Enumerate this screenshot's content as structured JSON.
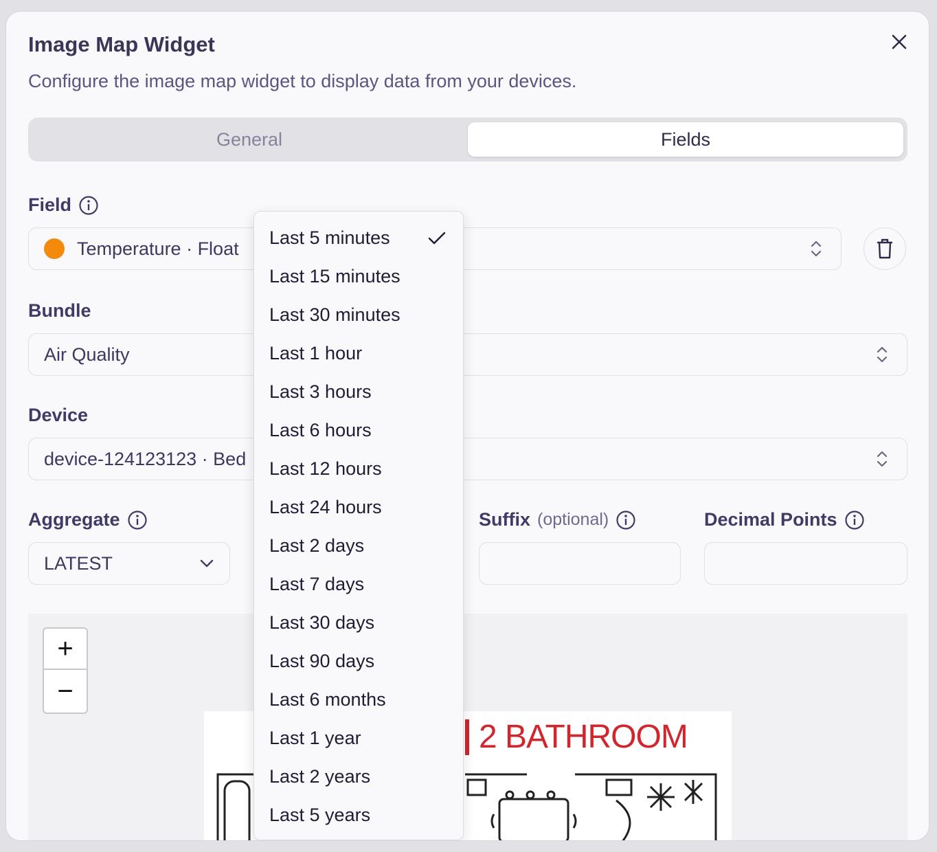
{
  "dialog": {
    "title": "Image Map Widget",
    "description": "Configure the image map widget to display data from your devices."
  },
  "tabs": [
    {
      "label": "General",
      "active": false
    },
    {
      "label": "Fields",
      "active": true
    }
  ],
  "field": {
    "label": "Field",
    "value": "Temperature · Float",
    "dot_color": "#f48a0c"
  },
  "bundle": {
    "label": "Bundle",
    "value": "Air Quality"
  },
  "device": {
    "label": "Device",
    "value": "device-124123123 · Bed"
  },
  "aggregate": {
    "label": "Aggregate",
    "value": "LATEST"
  },
  "suffix": {
    "label": "Suffix",
    "optional": "(optional)",
    "value": ""
  },
  "decimal_points": {
    "label": "Decimal Points",
    "value": ""
  },
  "map": {
    "zoom_in": "+",
    "zoom_out": "−",
    "room_label": "2 BATHROOM"
  },
  "time_range_menu": {
    "selected_index": 0,
    "options": [
      "Last 5 minutes",
      "Last 15 minutes",
      "Last 30 minutes",
      "Last 1 hour",
      "Last 3 hours",
      "Last 6 hours",
      "Last 12 hours",
      "Last 24 hours",
      "Last 2 days",
      "Last 7 days",
      "Last 30 days",
      "Last 90 days",
      "Last 6 months",
      "Last 1 year",
      "Last 2 years",
      "Last 5 years"
    ]
  },
  "colors": {
    "accent_orange": "#f48a0c",
    "room_label_red": "#d0262d"
  }
}
